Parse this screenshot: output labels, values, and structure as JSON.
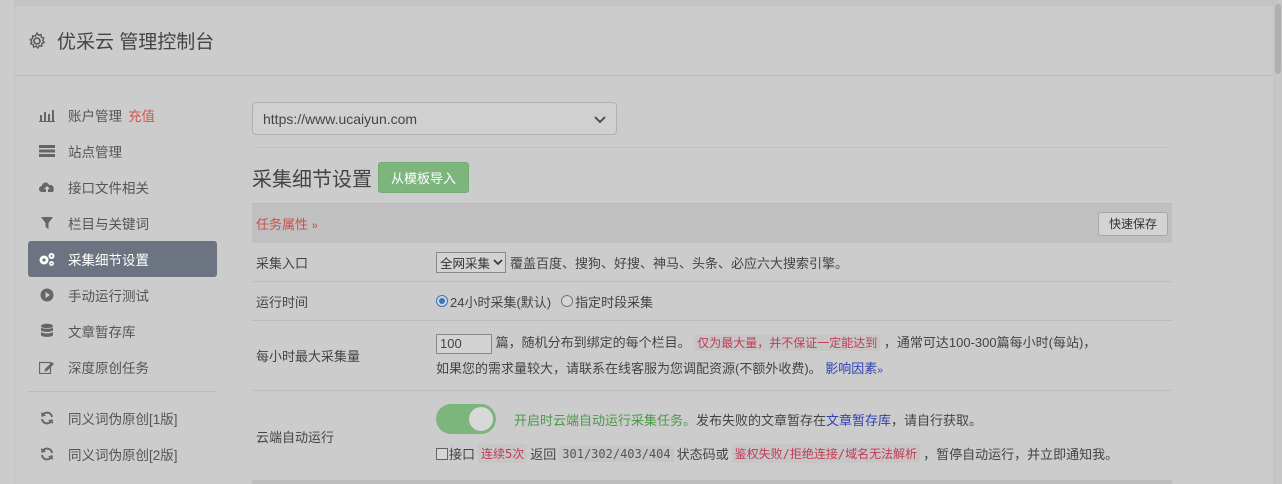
{
  "header": {
    "title": "优采云 管理控制台",
    "icon": "gear-icon"
  },
  "sidebar": {
    "items": [
      {
        "label": "账户管理",
        "extra": "充值",
        "icon": "bar-chart-icon"
      },
      {
        "label": "站点管理",
        "icon": "server-icon"
      },
      {
        "label": "接口文件相关",
        "icon": "cloud-upload-icon"
      },
      {
        "label": "栏目与关键词",
        "icon": "filter-icon"
      },
      {
        "label": "采集细节设置",
        "icon": "cogs-icon",
        "active": true
      },
      {
        "label": "手动运行测试",
        "icon": "play-circle-icon"
      },
      {
        "label": "文章暂存库",
        "icon": "database-icon"
      },
      {
        "label": "深度原创任务",
        "icon": "edit-icon"
      },
      {
        "label": "同义词伪原创[1版]",
        "icon": "refresh-icon"
      },
      {
        "label": "同义词伪原创[2版]",
        "icon": "refresh-icon"
      }
    ]
  },
  "main": {
    "site_select": "https://www.ucaiyun.com",
    "section_title": "采集细节设置",
    "import_button": "从模板导入",
    "panel": {
      "tag": "任务属性",
      "save_button": "快速保存",
      "rows": {
        "entry": {
          "label": "采集入口",
          "select_value": "全网采集",
          "desc": "覆盖百度、搜狗、好搜、神马、头条、必应六大搜索引擎。"
        },
        "runtime": {
          "label": "运行时间",
          "opt1": "24小时采集(默认)",
          "opt2": "指定时段采集"
        },
        "max_per_hour": {
          "label": "每小时最大采集量",
          "value": "100",
          "t1": "篇，随机分布到绑定的每个栏目。",
          "warn": "仅为最大量，并不保证一定能达到",
          "t2": "，通常可达100-300篇每小时(每站)，",
          "t3": "如果您的需求量较大，请联系在线客服为您调配资源(不额外收费)。",
          "link": "影响因素"
        },
        "cloud_auto": {
          "label": "云端自动运行",
          "enabled_text": "开启时云端自动运行采集任务。",
          "t1": "发布失败的文章暂存在",
          "link": "文章暂存库",
          "t2": "，请自行获取。",
          "chk_label": "接口",
          "code1": "连续5次",
          "t3": "返回",
          "code2": "301/302/403/404",
          "t4": "状态码或",
          "code3": "鉴权失败/拒绝连接/域名无法解析",
          "t5": "，暂停自动运行，并立即通知我。"
        }
      }
    }
  }
}
